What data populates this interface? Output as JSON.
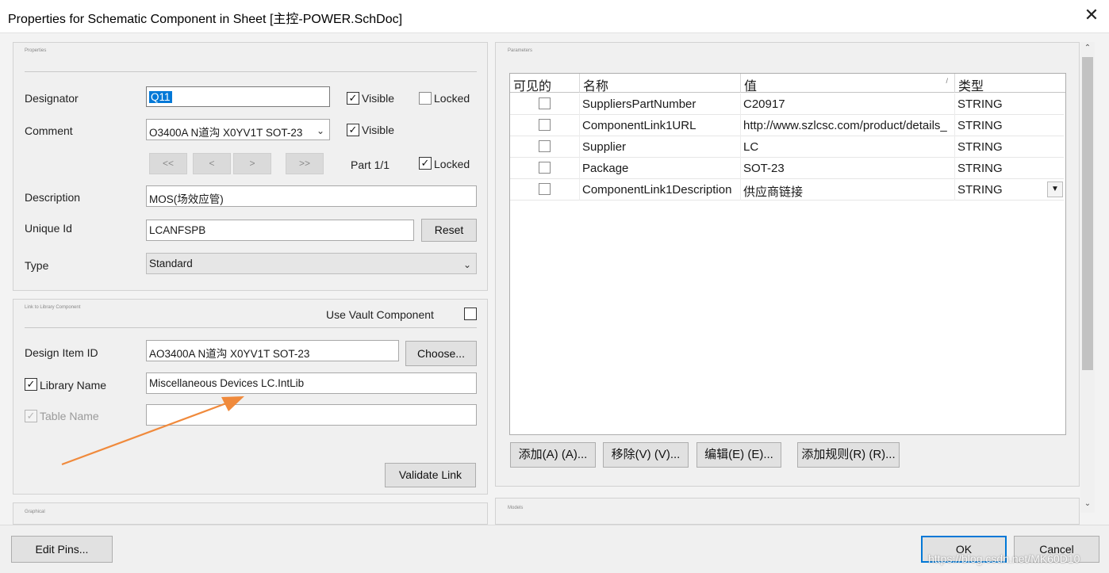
{
  "window": {
    "title": "Properties for Schematic Component in Sheet [主控-POWER.SchDoc]",
    "close_glyph": "✕"
  },
  "properties": {
    "section_title": "Properties",
    "designator": {
      "label": "Designator",
      "value": "Q11",
      "visible_label": "Visible",
      "visible_checked": true,
      "locked_label": "Locked",
      "locked_checked": false
    },
    "comment": {
      "label": "Comment",
      "value": "O3400A N道沟 X0YV1T SOT-23",
      "visible_label": "Visible",
      "visible_checked": true
    },
    "part_nav": {
      "first": "<<",
      "prev": "<",
      "next": ">",
      "last": ">>",
      "part_label": "Part 1/1",
      "locked_label": "Locked",
      "locked_checked": true
    },
    "description": {
      "label": "Description",
      "value": "MOS(场效应管)"
    },
    "unique_id": {
      "label": "Unique Id",
      "value": "LCANFSPB",
      "reset_label": "Reset"
    },
    "type": {
      "label": "Type",
      "value": "Standard"
    }
  },
  "link": {
    "section_title": "Link to Library Component",
    "use_vault_label": "Use Vault Component",
    "use_vault_checked": false,
    "design_item": {
      "label": "Design Item ID",
      "value": "AO3400A N道沟 X0YV1T SOT-23",
      "choose_label": "Choose..."
    },
    "library_name": {
      "label": "Library Name",
      "value": "Miscellaneous Devices LC.IntLib",
      "checked": true
    },
    "table_name": {
      "label": "Table Name",
      "value": "",
      "checked": true
    },
    "validate_label": "Validate Link"
  },
  "graphical": {
    "section_title": "Graphical"
  },
  "models": {
    "section_title": "Models"
  },
  "parameters": {
    "section_title": "Parameters",
    "columns": [
      "可见的",
      "名称",
      "值",
      "类型"
    ],
    "sort_glyph": "/",
    "rows": [
      {
        "visible": false,
        "name": "SuppliersPartNumber",
        "value": "C20917",
        "type": "STRING"
      },
      {
        "visible": false,
        "name": "ComponentLink1URL",
        "value": "http://www.szlcsc.com/product/details_",
        "type": "STRING"
      },
      {
        "visible": false,
        "name": "Supplier",
        "value": "LC",
        "type": "STRING"
      },
      {
        "visible": false,
        "name": "Package",
        "value": "SOT-23",
        "type": "STRING"
      },
      {
        "visible": false,
        "name": "ComponentLink1Description",
        "value": "供应商链接",
        "type": "STRING"
      }
    ],
    "buttons": {
      "add": "添加(A) (A)...",
      "remove": "移除(V) (V)...",
      "edit": "编辑(E) (E)...",
      "add_rule": "添加规则(R) (R)..."
    }
  },
  "footer": {
    "edit_pins": "Edit Pins...",
    "ok": "OK",
    "cancel": "Cancel",
    "watermark": "https://blog.csdn.net/MK60D10"
  },
  "colors": {
    "accent": "#0078d7",
    "arrow": "#f08a3c"
  }
}
